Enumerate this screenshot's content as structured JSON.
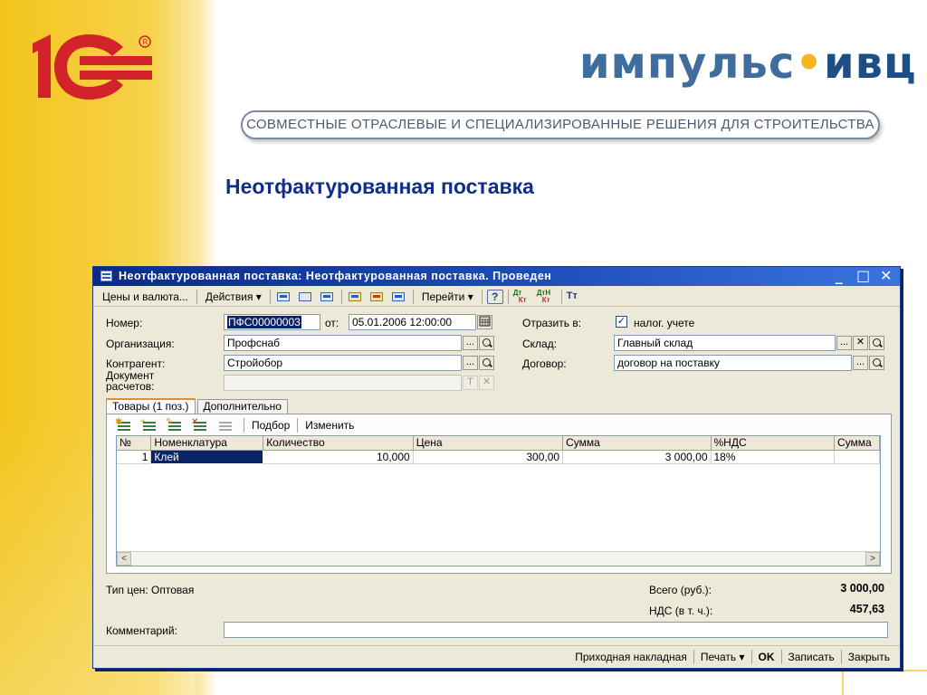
{
  "slide": {
    "logo_text": "1С",
    "brand_left": "импульс",
    "brand_dot": "•",
    "brand_right": "ивц",
    "tagline": "СОВМЕСТНЫЕ ОТРАСЛЕВЫЕ И СПЕЦИАЛИЗИРОВАННЫЕ РЕШЕНИЯ ДЛЯ СТРОИТЕЛЬСТВА",
    "title": "Неотфактурованная поставка"
  },
  "window": {
    "title": "Неотфактурованная поставка: Неотфактурованная поставка. Проведен",
    "controls": {
      "minimize": "_",
      "maximize": "□",
      "close": "✕"
    }
  },
  "toolbar": {
    "prices_label": "Цены и валюта...",
    "actions_label": "Действия ▾",
    "goto_label": "Перейти ▾",
    "help_label": "?",
    "icons": [
      "nav-back-icon",
      "doc-structure-icon",
      "refresh-icon",
      "post-icon",
      "unpost-icon",
      "copy-icon",
      "help-icon",
      "dt-kt-icon",
      "dt-kt-tax-icon",
      "text-format-icon"
    ],
    "dt_label": "Дт",
    "kt_label": "Кт",
    "dtn_label": "ДтН",
    "tt_label": "Тт"
  },
  "form": {
    "number_label": "Номер:",
    "number_value": "ПФС00000003",
    "from_label": "от:",
    "date_value": "05.01.2006 12:00:00",
    "reflect_label": "Отразить в:",
    "tax_check": "✓",
    "tax_label": "налог. учете",
    "org_label": "Организация:",
    "org_value": "Профснаб",
    "warehouse_label": "Склад:",
    "warehouse_value": "Главный склад",
    "contractor_label": "Контрагент:",
    "contractor_value": "Стройобор",
    "contract_label": "Договор:",
    "contract_value": "договор на поставку",
    "settlement_label_1": "Документ",
    "settlement_label_2": "расчетов:",
    "settlement_value": "",
    "btn_dots": "...",
    "btn_x": "✕",
    "btn_t": "T",
    "btn_tx": "✕"
  },
  "tabs": {
    "goods": "Товары (1 поз.)",
    "extra": "Дополнительно"
  },
  "table_tools": {
    "select_label": "Подбор",
    "edit_label": "Изменить"
  },
  "table": {
    "columns": [
      "№",
      "Номенклатура",
      "Количество",
      "Цена",
      "Сумма",
      "%НДС",
      "Сумма"
    ],
    "rows": [
      [
        "1",
        "Клей",
        "10,000",
        "300,00",
        "3 000,00",
        "18%",
        ""
      ]
    ],
    "scroll_left": "<",
    "scroll_right": ">"
  },
  "summary": {
    "price_type_label": "Тип цен: Оптовая",
    "total_label": "Всего (руб.):",
    "total_value": "3 000,00",
    "vat_label": "НДС (в т. ч.):",
    "vat_value": "457,63",
    "comment_label": "Комментарий:",
    "comment_value": ""
  },
  "footer": {
    "invoice_label": "Приходная накладная",
    "print_label": "Печать ▾",
    "ok_label": "OK",
    "save_label": "Записать",
    "close_label": "Закрыть"
  },
  "colors": {
    "accent_yellow": "#f2c51c",
    "logo_red": "#d2232a",
    "title_blue": "#102e8a",
    "titlebar_blue": "#0a2a86",
    "selection_navy": "#0a246a"
  }
}
